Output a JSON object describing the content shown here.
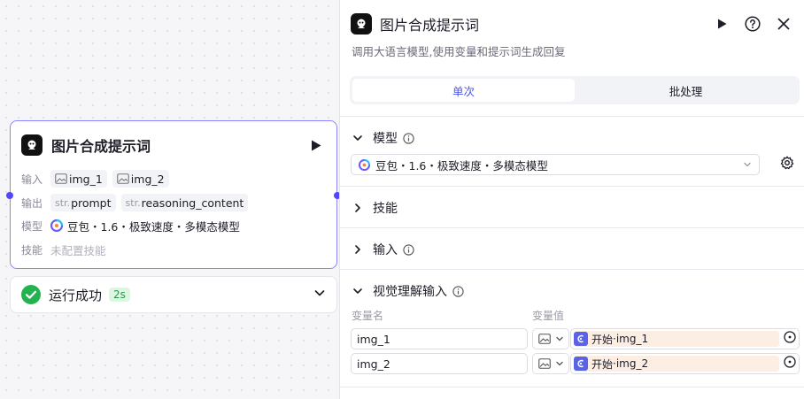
{
  "node": {
    "title": "图片合成提示词",
    "input_label": "输入",
    "inputs": [
      "img_1",
      "img_2"
    ],
    "output_label": "输出",
    "outputs": [
      {
        "type": "str.",
        "name": "prompt"
      },
      {
        "type": "str.",
        "name": "reasoning_content"
      }
    ],
    "model_label": "模型",
    "model_value": "豆包・1.6・极致速度・多模态模型",
    "skills_label": "技能",
    "skills_value": "未配置技能"
  },
  "status": {
    "text": "运行成功",
    "duration": "2s",
    "color": "#22b350"
  },
  "panel": {
    "title": "图片合成提示词",
    "description": "调用大语言模型,使用变量和提示词生成回复",
    "tabs": [
      {
        "label": "单次",
        "active": true
      },
      {
        "label": "批处理",
        "active": false
      }
    ],
    "sections": {
      "model": "模型",
      "skills": "技能",
      "input": "输入",
      "vision": "视觉理解输入"
    },
    "model_select": "豆包・1.6・极致速度・多模态模型",
    "columns": {
      "name": "变量名",
      "value": "变量值"
    },
    "vision_rows": [
      {
        "name": "img_1",
        "ref_source": "开始",
        "ref_var": "img_1"
      },
      {
        "name": "img_2",
        "ref_source": "开始",
        "ref_var": "img_2"
      }
    ]
  },
  "colors": {
    "accent": "#4d53e8",
    "node_border": "#8c84ff",
    "ref_tag_bg": "#fdeee4"
  }
}
